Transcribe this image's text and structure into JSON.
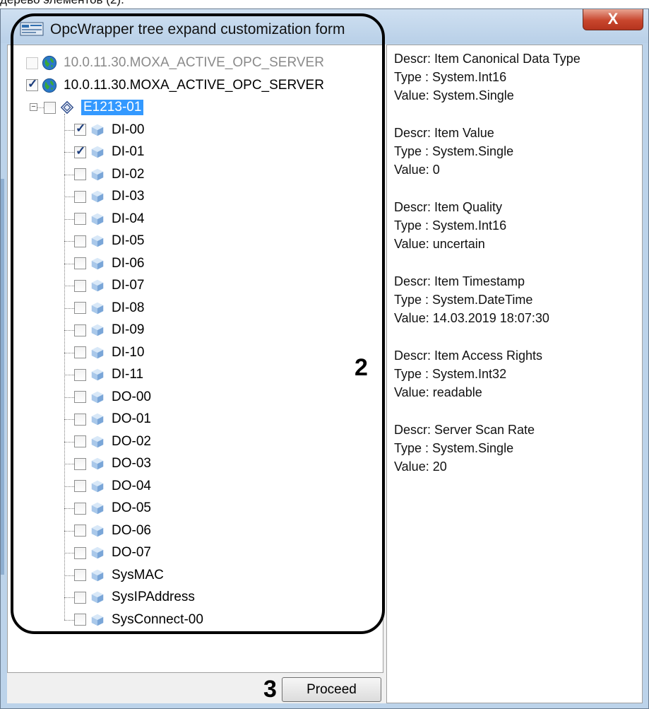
{
  "page_caption": "дерево элементов (2).",
  "window": {
    "title": "OpcWrapper tree expand customization form",
    "close_glyph": "X",
    "proceed_label": "Proceed"
  },
  "tree": {
    "servers": [
      {
        "label": "10.0.11.30.MOXA_ACTIVE_OPC_SERVER",
        "checked": false,
        "faded": true
      },
      {
        "label": "10.0.11.30.MOXA_ACTIVE_OPC_SERVER",
        "checked": true,
        "faded": false
      }
    ],
    "group": {
      "label": "E1213-01",
      "checked": false,
      "selected": true,
      "expanded": true
    },
    "items": [
      {
        "label": "DI-00",
        "checked": true
      },
      {
        "label": "DI-01",
        "checked": true
      },
      {
        "label": "DI-02",
        "checked": false
      },
      {
        "label": "DI-03",
        "checked": false
      },
      {
        "label": "DI-04",
        "checked": false
      },
      {
        "label": "DI-05",
        "checked": false
      },
      {
        "label": "DI-06",
        "checked": false
      },
      {
        "label": "DI-07",
        "checked": false
      },
      {
        "label": "DI-08",
        "checked": false
      },
      {
        "label": "DI-09",
        "checked": false
      },
      {
        "label": "DI-10",
        "checked": false
      },
      {
        "label": "DI-11",
        "checked": false
      },
      {
        "label": "DO-00",
        "checked": false
      },
      {
        "label": "DO-01",
        "checked": false
      },
      {
        "label": "DO-02",
        "checked": false
      },
      {
        "label": "DO-03",
        "checked": false
      },
      {
        "label": "DO-04",
        "checked": false
      },
      {
        "label": "DO-05",
        "checked": false
      },
      {
        "label": "DO-06",
        "checked": false
      },
      {
        "label": "DO-07",
        "checked": false
      },
      {
        "label": "SysMAC",
        "checked": false
      },
      {
        "label": "SysIPAddress",
        "checked": false
      },
      {
        "label": "SysConnect-00",
        "checked": false
      }
    ]
  },
  "properties": [
    {
      "descr": "Descr: Item Canonical Data Type",
      "type": "Type : System.Int16",
      "value": "Value: System.Single"
    },
    {
      "descr": "Descr: Item Value",
      "type": "Type : System.Single",
      "value": "Value: 0"
    },
    {
      "descr": "Descr: Item Quality",
      "type": "Type : System.Int16",
      "value": "Value: uncertain"
    },
    {
      "descr": "Descr: Item Timestamp",
      "type": "Type : System.DateTime",
      "value": "Value: 14.03.2019 18:07:30"
    },
    {
      "descr": "Descr: Item Access Rights",
      "type": "Type : System.Int32",
      "value": "Value: readable"
    },
    {
      "descr": "Descr: Server Scan Rate",
      "type": "Type : System.Single",
      "value": "Value: 20"
    }
  ],
  "annotations": {
    "tree_marker": "2",
    "button_marker": "3"
  },
  "icons": {
    "app": "opc-wrapper-icon",
    "server": "globe-icon",
    "group": "group-diamond-icon",
    "item": "cube-icon",
    "close": "close-icon"
  }
}
